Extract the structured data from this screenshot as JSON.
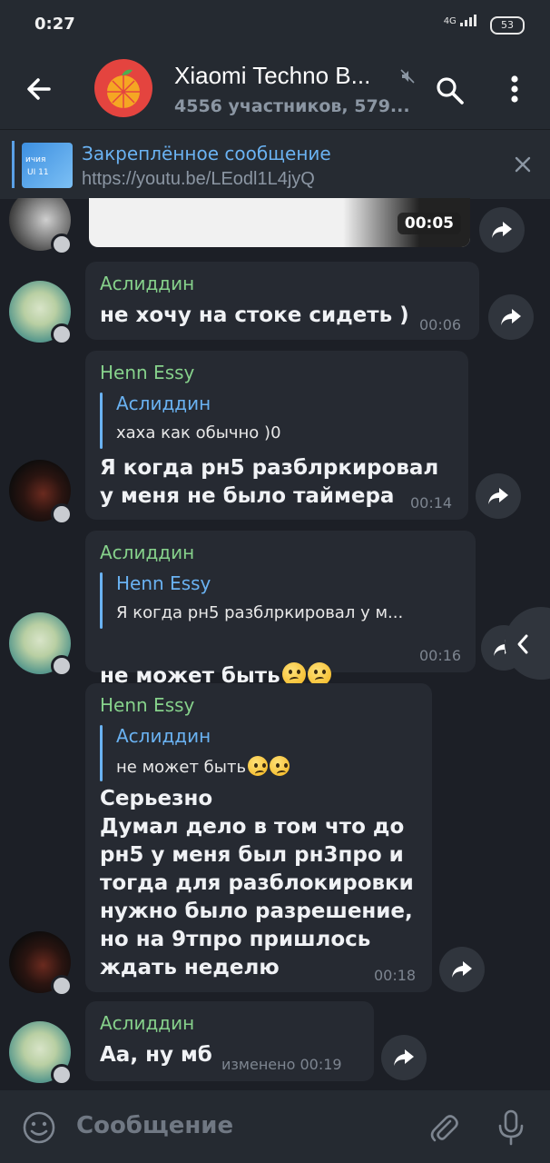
{
  "status_bar": {
    "time": "0:27",
    "network": "4G",
    "battery": "53"
  },
  "header": {
    "title": "Xiaomi Techno B...",
    "subtitle": "4556 участников, 579..."
  },
  "pinned": {
    "title": "Закреплённое сообщение",
    "link": "https://youtu.be/LEodl1L4jyQ",
    "thumb_text": [
      "ичия",
      "UI 11"
    ]
  },
  "messages": [
    {
      "type": "media",
      "time": "00:05"
    },
    {
      "sender": "Аслиддин",
      "text": "не хочу на стоке сидеть )",
      "time": "00:06"
    },
    {
      "sender": "Henn Essy",
      "reply": {
        "name": "Аслиддин",
        "text": "хаха как обычно )0"
      },
      "text": "Я когда рн5 разблркировал\nу меня не было таймера",
      "time": "00:14"
    },
    {
      "sender": "Аслиддин",
      "reply": {
        "name": "Henn Essy",
        "text": "Я когда рн5 разблркировал у м..."
      },
      "text": "не может быть",
      "time": "00:16"
    },
    {
      "sender": "Henn Essy",
      "reply": {
        "name": "Аслиддин",
        "text": "не может быть"
      },
      "text": "Серьезно\nДумал дело в том что до\nрн5 у меня был рн3про и\nтогда для разблокировки\nнужно было разрешение,\nно на 9тпро пришлось\nждать неделю",
      "time": "00:18"
    },
    {
      "sender": "Аслиддин",
      "text": "Аа, ну мб",
      "time": "изменено 00:19"
    }
  ],
  "composer": {
    "placeholder": "Сообщение"
  }
}
